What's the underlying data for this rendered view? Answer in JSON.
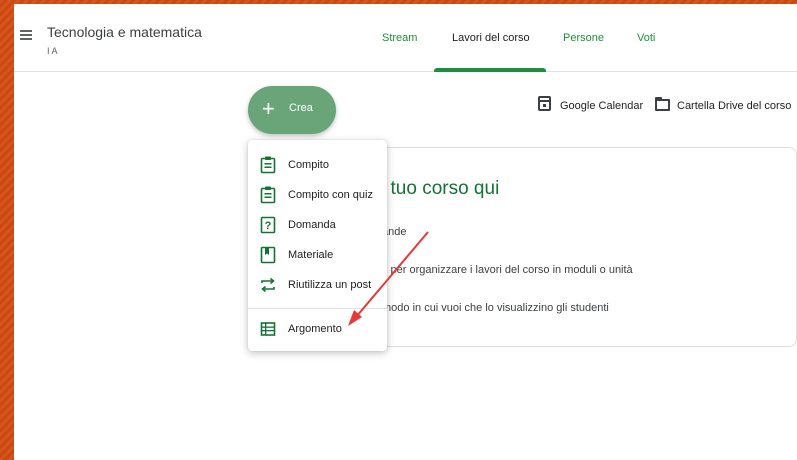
{
  "header": {
    "course_title": "Tecnologia e matematica",
    "course_section": "I A",
    "tabs": [
      {
        "label": "Stream",
        "active": false
      },
      {
        "label": "Lavori del corso",
        "active": true
      },
      {
        "label": "Persone",
        "active": false
      },
      {
        "label": "Voti",
        "active": false
      }
    ]
  },
  "toolbar": {
    "create_label": "Crea",
    "calendar_label": "Google Calendar",
    "drive_label": "Cartella Drive del corso"
  },
  "card": {
    "title": "l tuo corso qui",
    "lines": [
      "ande",
      "ti per organizzare i lavori del corso in moduli o unità",
      "modo in cui vuoi che lo visualizzino gli studenti"
    ]
  },
  "create_menu": {
    "items": [
      {
        "label": "Compito",
        "icon": "assignment-icon"
      },
      {
        "label": "Compito con quiz",
        "icon": "quiz-assignment-icon"
      },
      {
        "label": "Domanda",
        "icon": "question-icon"
      },
      {
        "label": "Materiale",
        "icon": "material-icon"
      },
      {
        "label": "Riutilizza un post",
        "icon": "reuse-post-icon"
      },
      {
        "label": "Argomento",
        "icon": "topic-icon"
      }
    ]
  },
  "colors": {
    "accent_green": "#1e8e3e",
    "create_button": "#6aa57a",
    "annotation_arrow": "#e53935"
  }
}
